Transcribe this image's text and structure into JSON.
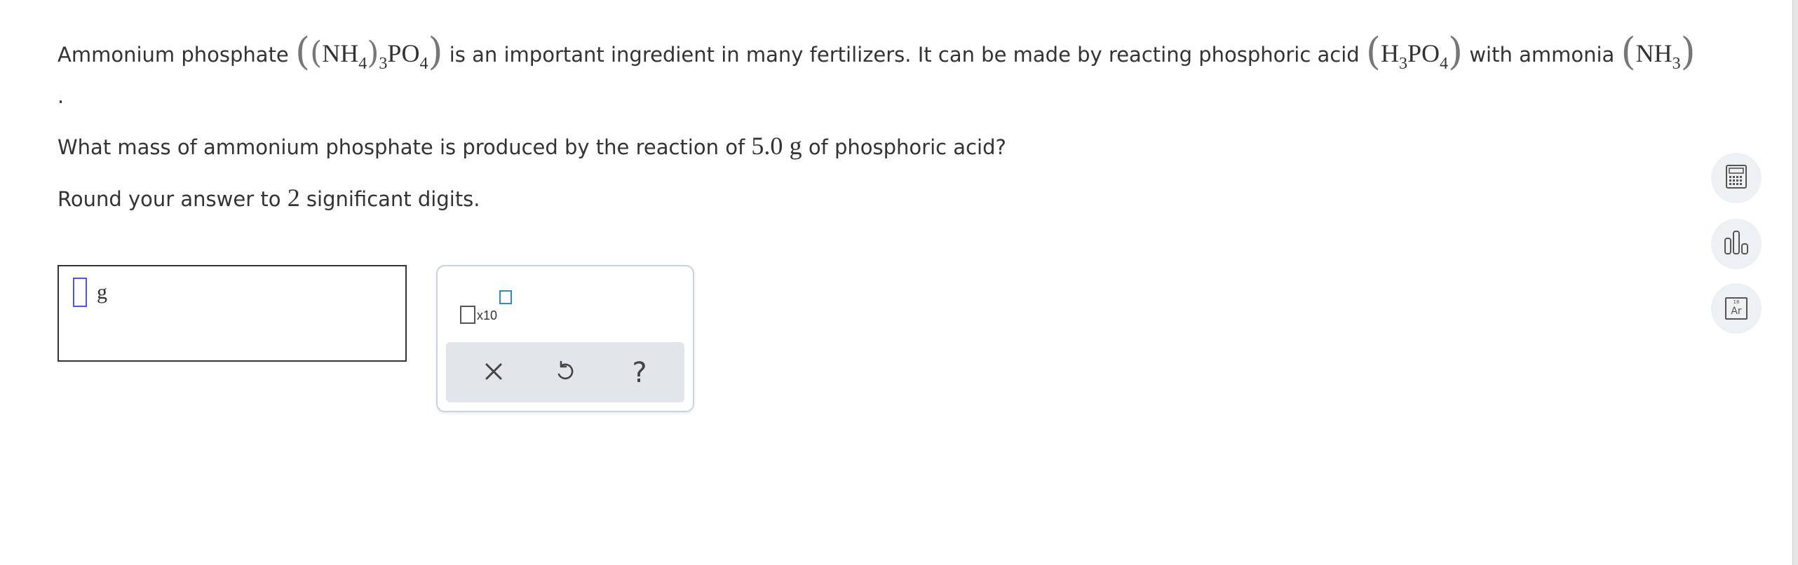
{
  "question": {
    "line1": {
      "t1": "Ammonium phosphate",
      "f1_nh": "NH",
      "f1_sub4a": "4",
      "f1_sub3": "3",
      "f1_po": "PO",
      "f1_sub4b": "4",
      "t2": "is an important ingredient in many fertilizers. It can be made by reacting phosphoric acid",
      "f2_h": "H",
      "f2_sub3": "3",
      "f2_po": "PO",
      "f2_sub4": "4",
      "t3": "with ammonia",
      "f3_nh": "NH",
      "f3_sub3": "3"
    },
    "dot": ".",
    "line3": {
      "t1": "What mass of ammonium phosphate is produced by the reaction of",
      "value": "5.0",
      "unit": "g",
      "t2": "of phosphoric acid?"
    },
    "line4": {
      "t1": "Round your answer to",
      "digits": "2",
      "t2": "significant digits."
    }
  },
  "answer": {
    "value": "",
    "unit": "g"
  },
  "keypad": {
    "sci_label": "x10",
    "clear_icon": "close-icon",
    "undo_icon": "undo-icon",
    "help_label": "?"
  },
  "sidebar": {
    "calculator_icon": "calculator-icon",
    "chart_icon": "bar-chart-icon",
    "periodic_label_num": "18",
    "periodic_label": "Ar"
  },
  "colors": {
    "cursor": "#4c57e6",
    "sci_exp": "#2e8fbf",
    "tray": "#e2e6ea",
    "side_btn": "#eef1f4"
  }
}
